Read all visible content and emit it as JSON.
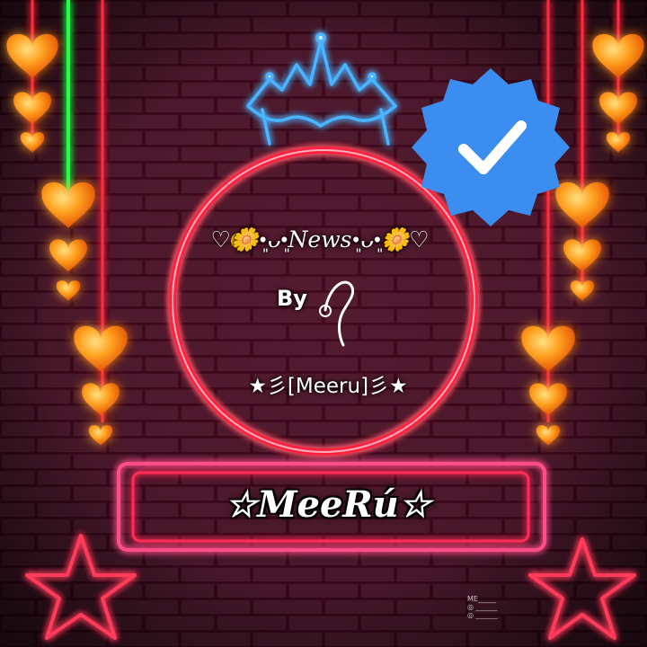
{
  "colors": {
    "wall_pink": "#c3306f",
    "mortar": "#3a0a1e",
    "neon_red": "#ff2040",
    "neon_pink": "#ff4d8a",
    "neon_green": "#22ff44",
    "neon_blue": "#2a9cff",
    "heart_orange": "#ff9a10",
    "badge_blue": "#3b8ef0"
  },
  "icons": {
    "crown": "neon-crown-icon",
    "badge": "verified-check-icon",
    "hearts": "heart-icon",
    "stars": "neon-star-icon"
  },
  "circle_text": {
    "news_line": "♡🌼•͈ᴗ•͈News•͈ᴗ•͈🌼♡",
    "by": "By",
    "name_line": "★彡[Meeru]彡★"
  },
  "banner": {
    "name": "☆MeeRú☆"
  },
  "watermark": {
    "lines": [
      "ME_____",
      "◎ ______",
      "◎ ______"
    ]
  }
}
